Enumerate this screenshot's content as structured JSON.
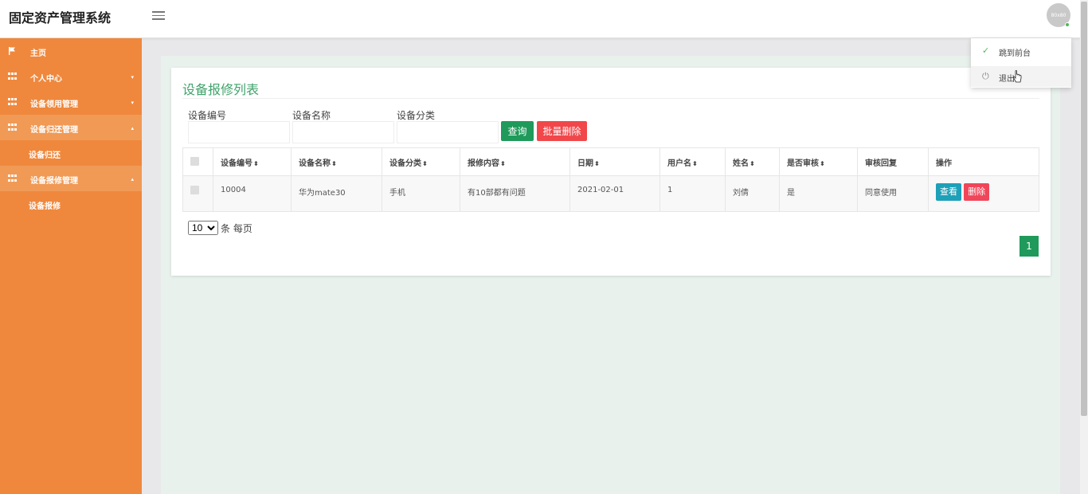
{
  "app": {
    "title": "固定资产管理系统",
    "avatar_text": "80x80"
  },
  "sidebar": {
    "items": [
      {
        "label": "主页",
        "icon": "flag-icon",
        "caret": ""
      },
      {
        "label": "个人中心",
        "icon": "grid-icon",
        "caret": "▾"
      },
      {
        "label": "设备领用管理",
        "icon": "grid-icon",
        "caret": "▾"
      },
      {
        "label": "设备归还管理",
        "icon": "grid-icon",
        "caret": "▴",
        "sub": "设备归还"
      },
      {
        "label": "设备报修管理",
        "icon": "grid-icon",
        "caret": "▴",
        "sub": "设备报修"
      }
    ]
  },
  "dropdown": {
    "item1": "跳到前台",
    "item2": "退出"
  },
  "panel": {
    "title": "设备报修列表",
    "search": {
      "code_label": "设备编号",
      "name_label": "设备名称",
      "category_label": "设备分类",
      "query_button": "查询",
      "batch_delete_button": "批量删除"
    },
    "table": {
      "headers": [
        "设备编号",
        "设备名称",
        "设备分类",
        "报修内容",
        "日期",
        "用户名",
        "姓名",
        "是否审核",
        "审核回复",
        "操作"
      ],
      "rows": [
        {
          "code": "10004",
          "name": "华为mate30",
          "category": "手机",
          "content": "有10部都有问题",
          "date": "2021-02-01",
          "username": "1",
          "realname": "刘倩",
          "audited": "是",
          "reply": "同意使用",
          "view": "查看",
          "delete": "删除"
        }
      ]
    },
    "page_size": "10",
    "page_size_suffix": "条 每页",
    "current_page": "1"
  }
}
